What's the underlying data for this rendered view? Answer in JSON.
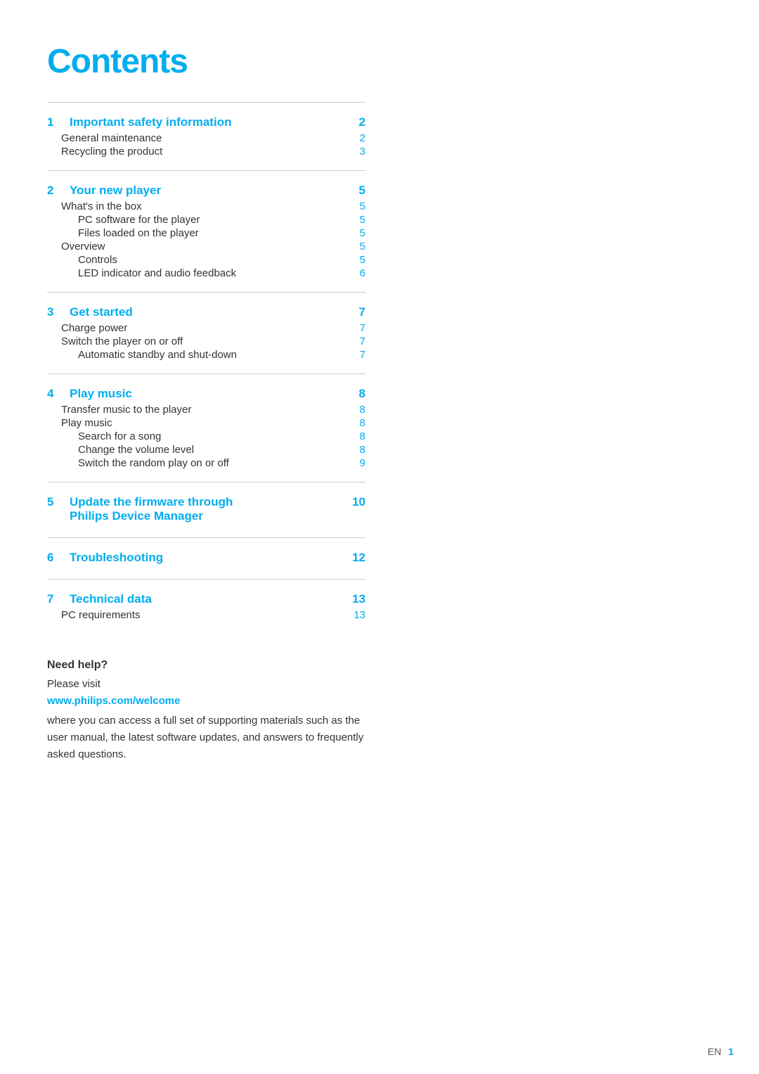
{
  "page": {
    "title": "Contents",
    "footer": {
      "lang": "EN",
      "page_num": "1"
    }
  },
  "sections": [
    {
      "num": "1",
      "heading": "Important safety information",
      "heading_page": "2",
      "items": [
        {
          "label": "General maintenance",
          "page": "2",
          "indent": "top"
        },
        {
          "label": "Recycling the product",
          "page": "3",
          "indent": "top"
        }
      ]
    },
    {
      "num": "2",
      "heading": "Your new player",
      "heading_page": "5",
      "items": [
        {
          "label": "What's in the box",
          "page": "5",
          "indent": "top"
        },
        {
          "label": "PC software for the player",
          "page": "5",
          "indent": "sub"
        },
        {
          "label": "Files loaded on the player",
          "page": "5",
          "indent": "sub"
        },
        {
          "label": "Overview",
          "page": "5",
          "indent": "top"
        },
        {
          "label": "Controls",
          "page": "5",
          "indent": "sub"
        },
        {
          "label": "LED indicator and audio feedback",
          "page": "6",
          "indent": "sub"
        }
      ]
    },
    {
      "num": "3",
      "heading": "Get started",
      "heading_page": "7",
      "items": [
        {
          "label": "Charge power",
          "page": "7",
          "indent": "top"
        },
        {
          "label": "Switch the player on or off",
          "page": "7",
          "indent": "top"
        },
        {
          "label": "Automatic standby and shut-down",
          "page": "7",
          "indent": "sub"
        }
      ]
    },
    {
      "num": "4",
      "heading": "Play music",
      "heading_page": "8",
      "items": [
        {
          "label": "Transfer music to the player",
          "page": "8",
          "indent": "top"
        },
        {
          "label": "Play music",
          "page": "8",
          "indent": "top"
        },
        {
          "label": "Search for a song",
          "page": "8",
          "indent": "sub"
        },
        {
          "label": "Change the volume level",
          "page": "8",
          "indent": "sub"
        },
        {
          "label": "Switch the random play on or off",
          "page": "9",
          "indent": "sub"
        }
      ]
    },
    {
      "num": "5",
      "heading": "Update the firmware through\nPhilips Device Manager",
      "heading_page": "10",
      "items": []
    },
    {
      "num": "6",
      "heading": "Troubleshooting",
      "heading_page": "12",
      "items": []
    },
    {
      "num": "7",
      "heading": "Technical data",
      "heading_page": "13",
      "items": [
        {
          "label": "PC requirements",
          "page": "13",
          "indent": "top"
        }
      ]
    }
  ],
  "help": {
    "need_help_label": "Need help?",
    "please_visit_label": "Please visit",
    "website": "www.philips.com/welcome",
    "description": "where you can access a full set of supporting materials such as the user manual, the latest software updates, and answers to frequently asked questions."
  }
}
